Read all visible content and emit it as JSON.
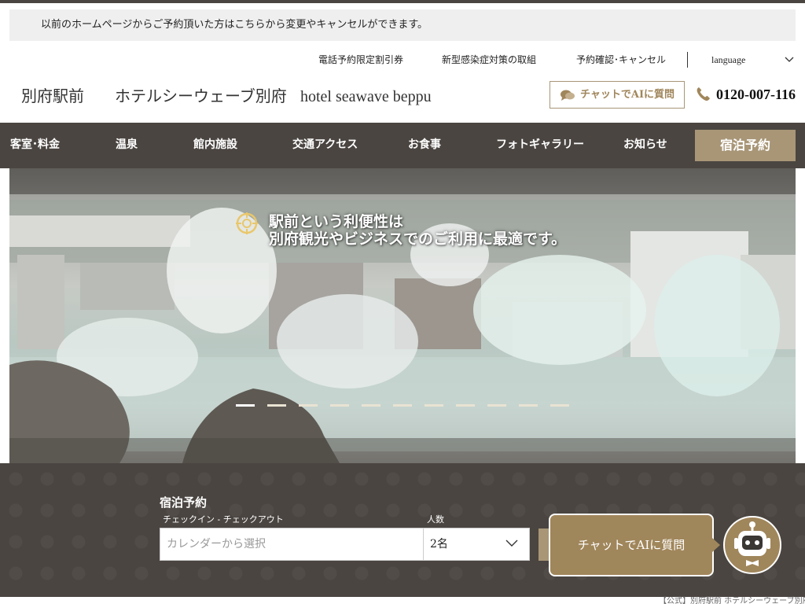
{
  "notice": {
    "text": "以前のホームページからご予約頂いた方はこちらから変更やキャンセルができます。"
  },
  "utility_links": {
    "phone_discount": "電話予約限定割引券",
    "covid": "新型感染症対策の取組",
    "confirm_cancel": "予約確認･キャンセル",
    "language": "language"
  },
  "brand": {
    "prefix": "別府駅前",
    "name_ja": "ホテルシーウェーブ別府",
    "name_en": "hotel seawave beppu"
  },
  "header": {
    "chat_label": "チャットでAIに質問",
    "phone": "0120-007-116"
  },
  "nav": {
    "items": [
      {
        "label": "客室･料金"
      },
      {
        "label": "温泉"
      },
      {
        "label": "館内施設"
      },
      {
        "label": "交通アクセス"
      },
      {
        "label": "お食事"
      },
      {
        "label": "フォトギャラリー"
      },
      {
        "label": "お知らせ"
      }
    ],
    "reserve_label": "宿泊予約"
  },
  "hero": {
    "line1": "駅前という利便性は",
    "line2": "別府観光やビジネスでのご利用に最適です。",
    "slide_count": 11,
    "active_slide": 1
  },
  "booking": {
    "title": "宿泊予約",
    "checkin_label": "チェックイン - チェックアウト",
    "date_placeholder": "カレンダーから選択",
    "people_label": "人数",
    "people_value": "2名"
  },
  "chat_widget": {
    "label": "チャットでAIに質問"
  },
  "footer": {
    "note": "【公式】別府駅前 ホテルシーウェーブ別府"
  },
  "colors": {
    "dark": "#4a4541",
    "gold": "#a89677",
    "gold_dark": "#a0865b",
    "notice_bg": "#efefef"
  }
}
